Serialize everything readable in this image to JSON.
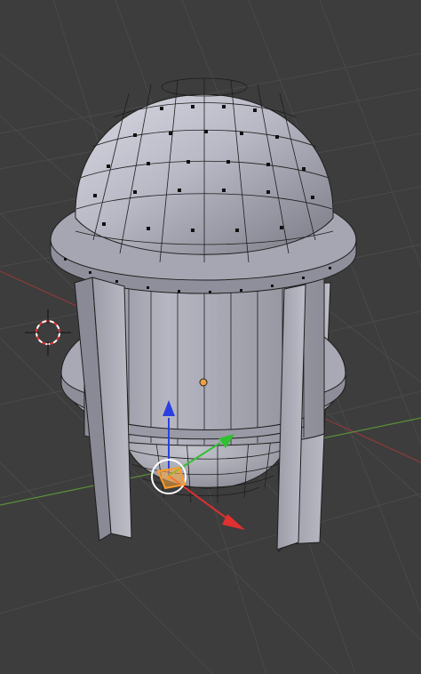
{
  "viewport": {
    "background": "#3d3d3d",
    "grid_color": "#4a4a4a",
    "x_axis_color": "#8f3a3a",
    "y_axis_color": "#5a8f3a",
    "mode": "edit-mesh"
  },
  "object": {
    "name": "",
    "mesh_color": "#b9b9c4",
    "edge_color": "#1e1e1e",
    "vertex_color": "#000000"
  },
  "gizmo": {
    "x_color": "#e03030",
    "y_color": "#30c030",
    "z_color": "#2a40e0",
    "center_ring": "#ffffff",
    "selection_color": "#ff9a2a"
  },
  "cursor_3d": {
    "ring_colors": [
      "#e33",
      "#ffffff"
    ]
  },
  "icons": [
    "3d-cursor-icon",
    "transform-gizmo-icon",
    "origin-dot-icon"
  ]
}
